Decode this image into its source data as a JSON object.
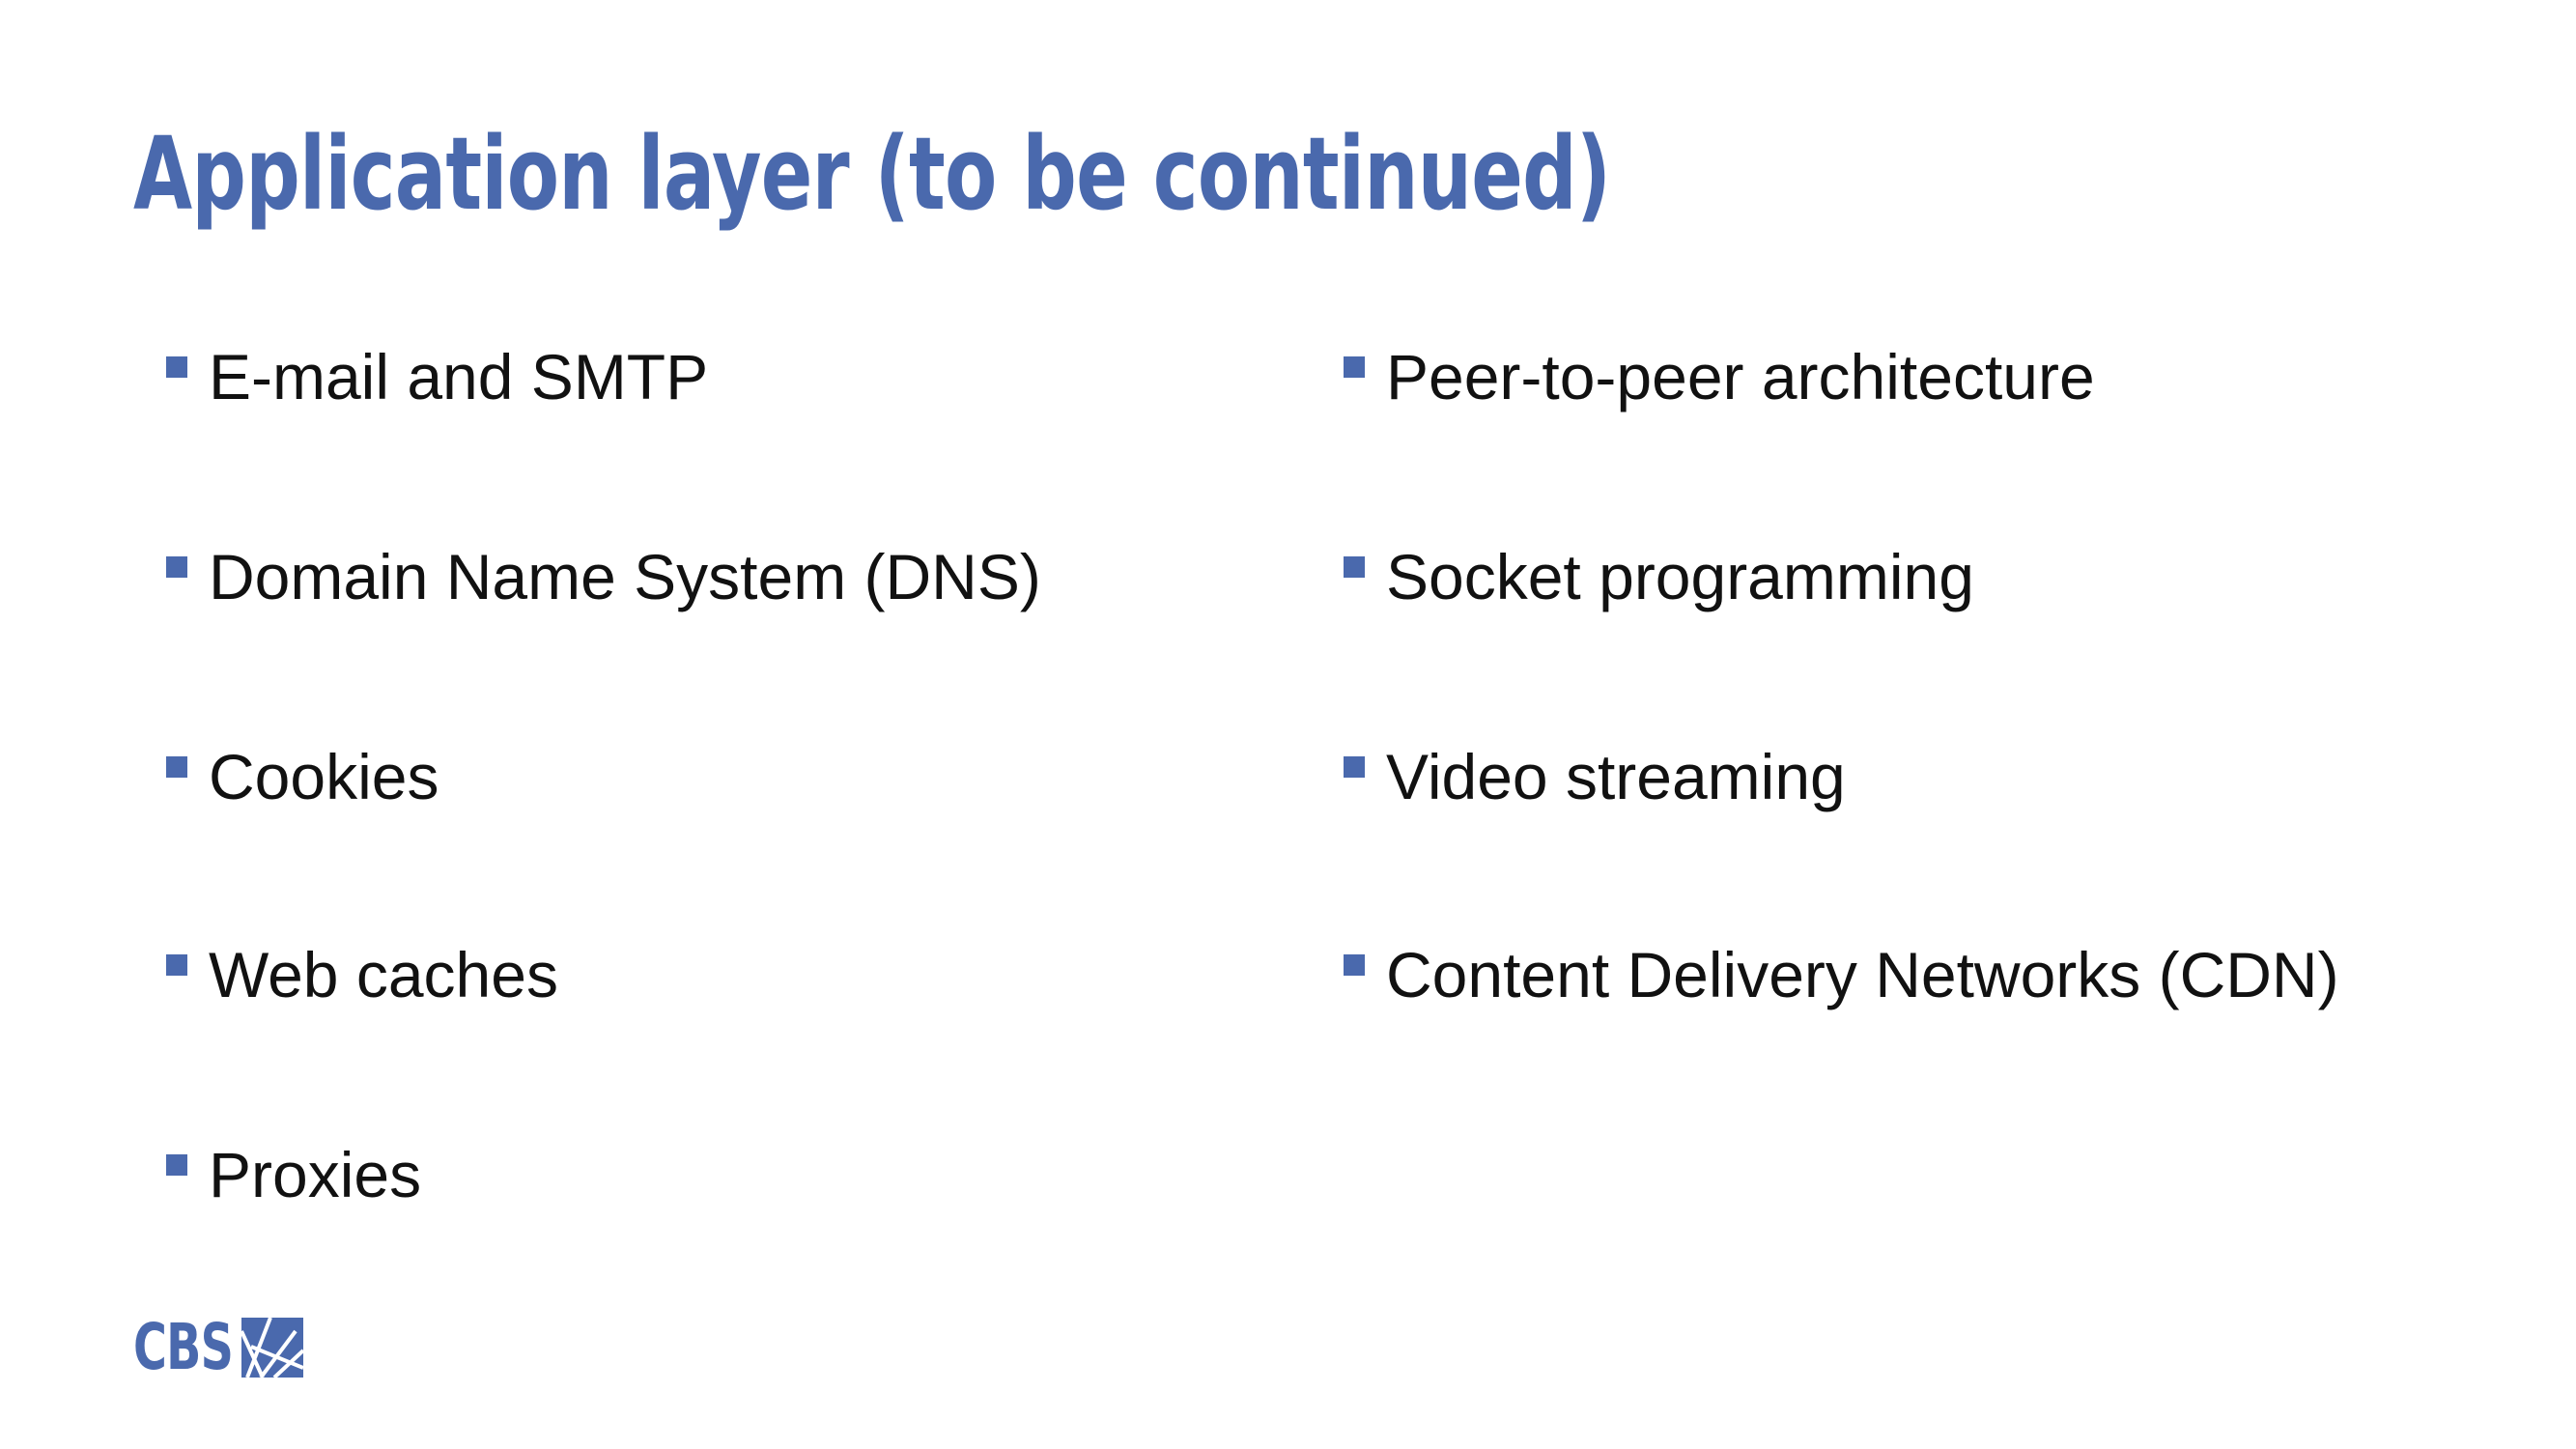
{
  "slide": {
    "title": "Application layer (to be continued)",
    "colors": {
      "accent": "#4a69ad",
      "text": "#111111",
      "background": "#ffffff"
    },
    "left_items": [
      {
        "label": "E-mail and SMTP"
      },
      {
        "label": "Domain Name System (DNS)"
      },
      {
        "label": "Cookies"
      },
      {
        "label": "Web caches"
      },
      {
        "label": "Proxies"
      }
    ],
    "right_items": [
      {
        "label": "Peer-to-peer architecture"
      },
      {
        "label": "Socket programming"
      },
      {
        "label": "Video streaming"
      },
      {
        "label": "Content Delivery Networks (CDN)"
      }
    ],
    "logo": {
      "text": "CBS",
      "icon": "cbs-logo-mark-icon"
    }
  }
}
